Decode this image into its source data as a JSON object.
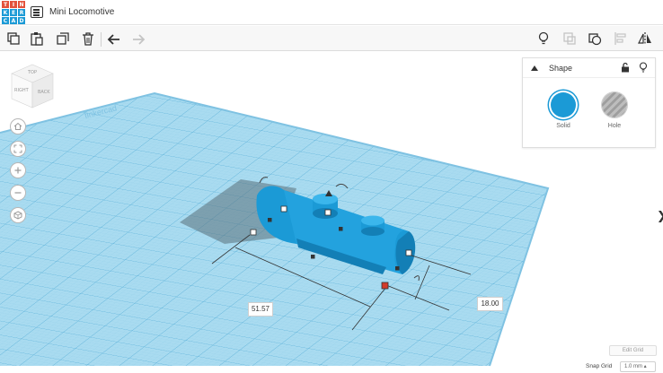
{
  "app": {
    "logo_letters": [
      "T",
      "I",
      "N",
      "K",
      "E",
      "R",
      "C",
      "A",
      "D"
    ],
    "logo_colors": [
      "#e3523b",
      "#e3523b",
      "#e3523b",
      "#1b9ad6",
      "#1b9ad6",
      "#1b9ad6",
      "#1b9ad6",
      "#1b9ad6",
      "#1b9ad6"
    ],
    "design_title": "Mini Locomotive"
  },
  "toolbar": {
    "left_icons": [
      "copy-icon",
      "paste-icon",
      "duplicate-icon",
      "trash-icon",
      "undo-icon",
      "redo-icon"
    ],
    "right_icons": [
      "lightbulb-icon",
      "group-icon",
      "ungroup-icon",
      "align-icon",
      "mirror-icon"
    ]
  },
  "viewcube": {
    "front_label": "RIGHT",
    "side_label": "BACK",
    "top_label": "TOP"
  },
  "inspector": {
    "title": "Shape",
    "solid_label": "Solid",
    "hole_label": "Hole",
    "accent": "#1b9ad6"
  },
  "dimensions": {
    "length": "51.57",
    "width": "18.00"
  },
  "footer": {
    "edit_grid": "Edit Grid",
    "snap_grid_label": "Snap Grid",
    "snap_grid_value": "1.0 mm ▴"
  },
  "colors": {
    "grid": "#9fd3eb",
    "grid_line": "#6cbbe0",
    "shape": "#1b9ad6",
    "shape_dark": "#137fb6"
  }
}
